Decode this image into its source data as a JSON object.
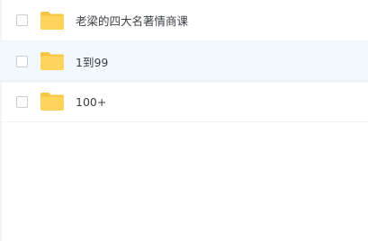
{
  "file_list": {
    "items": [
      {
        "name": "老梁的四大名著情商课",
        "icon": "folder-icon",
        "selected": false
      },
      {
        "name": "1到99",
        "icon": "folder-icon",
        "selected": true
      },
      {
        "name": "100+",
        "icon": "folder-icon",
        "selected": false
      }
    ]
  },
  "colors": {
    "folder": "#ffd45c",
    "folder_tab": "#f7c544",
    "selected_row": "#f1f8fe"
  }
}
